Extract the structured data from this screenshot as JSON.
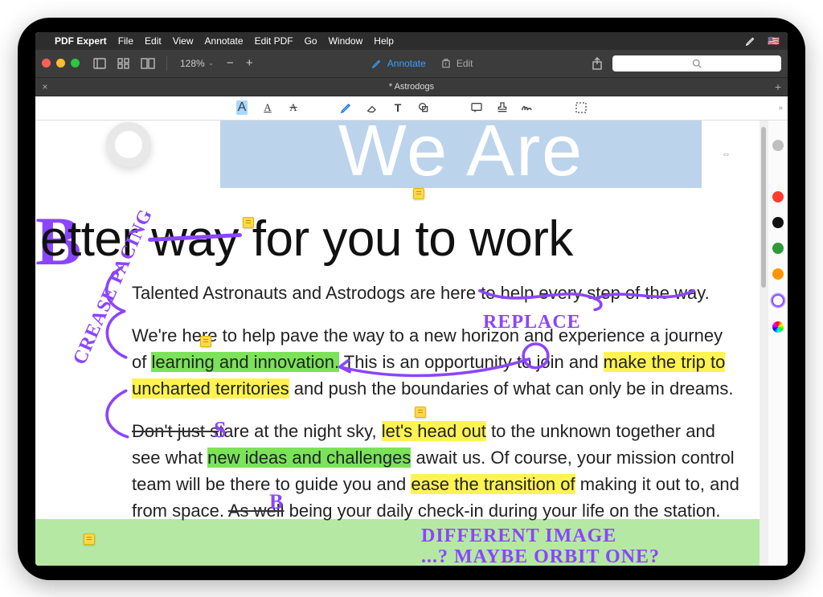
{
  "menubar": {
    "app_name": "PDF Expert",
    "items": [
      "File",
      "Edit",
      "View",
      "Annotate",
      "Edit PDF",
      "Go",
      "Window",
      "Help"
    ]
  },
  "toolbar": {
    "zoom": "128%",
    "modes": {
      "annotate": "Annotate",
      "edit": "Edit"
    },
    "search_placeholder": ""
  },
  "tabs": {
    "doc_title": "* Astrodogs"
  },
  "document": {
    "banner": "We Are",
    "headline_prefix": "etter ",
    "headline_struck": "way",
    "headline_suffix": " for you to work",
    "big_letter": "B",
    "para1": "Talented Astronauts and Astrodogs are here to help every step of the way.",
    "para2_a": "We're here to help pave the way to a new horizon and experience a journey of ",
    "para2_hl1": "learning and innovation.",
    "para2_b": " This is an opportunity to join and ",
    "para2_hl2": "make the trip to uncharted territories",
    "para2_c": " and push the boundaries of what can only be in dreams.",
    "para3_strike1": "Don't just s",
    "para3_a": "tare at the night sky, ",
    "para3_hl1": "let's head out",
    "para3_b": " to the unknown together and see what ",
    "para3_hl2": "new ideas and challenges",
    "para3_c": " await us. Of course, your mission control team will be there to guide you and ",
    "para3_hl3": "ease the transition of",
    "para3_d": " making it out to, and from space. ",
    "para3_strike2": "As well",
    "para3_e": " being your daily check-in during your life on the station.",
    "hand_increase": "CREASE PACING",
    "hand_replace": "REPLACE",
    "hand_diffimg_l1": "DIFFERENT IMAGE",
    "hand_diffimg_l2": "...? MAYBE ORBIT ONE?",
    "hand_s": "S",
    "hand_b": "B"
  },
  "colors": {
    "purple": "#8b45ff",
    "highlight_yellow": "#fff352",
    "highlight_green": "#7be25a"
  }
}
